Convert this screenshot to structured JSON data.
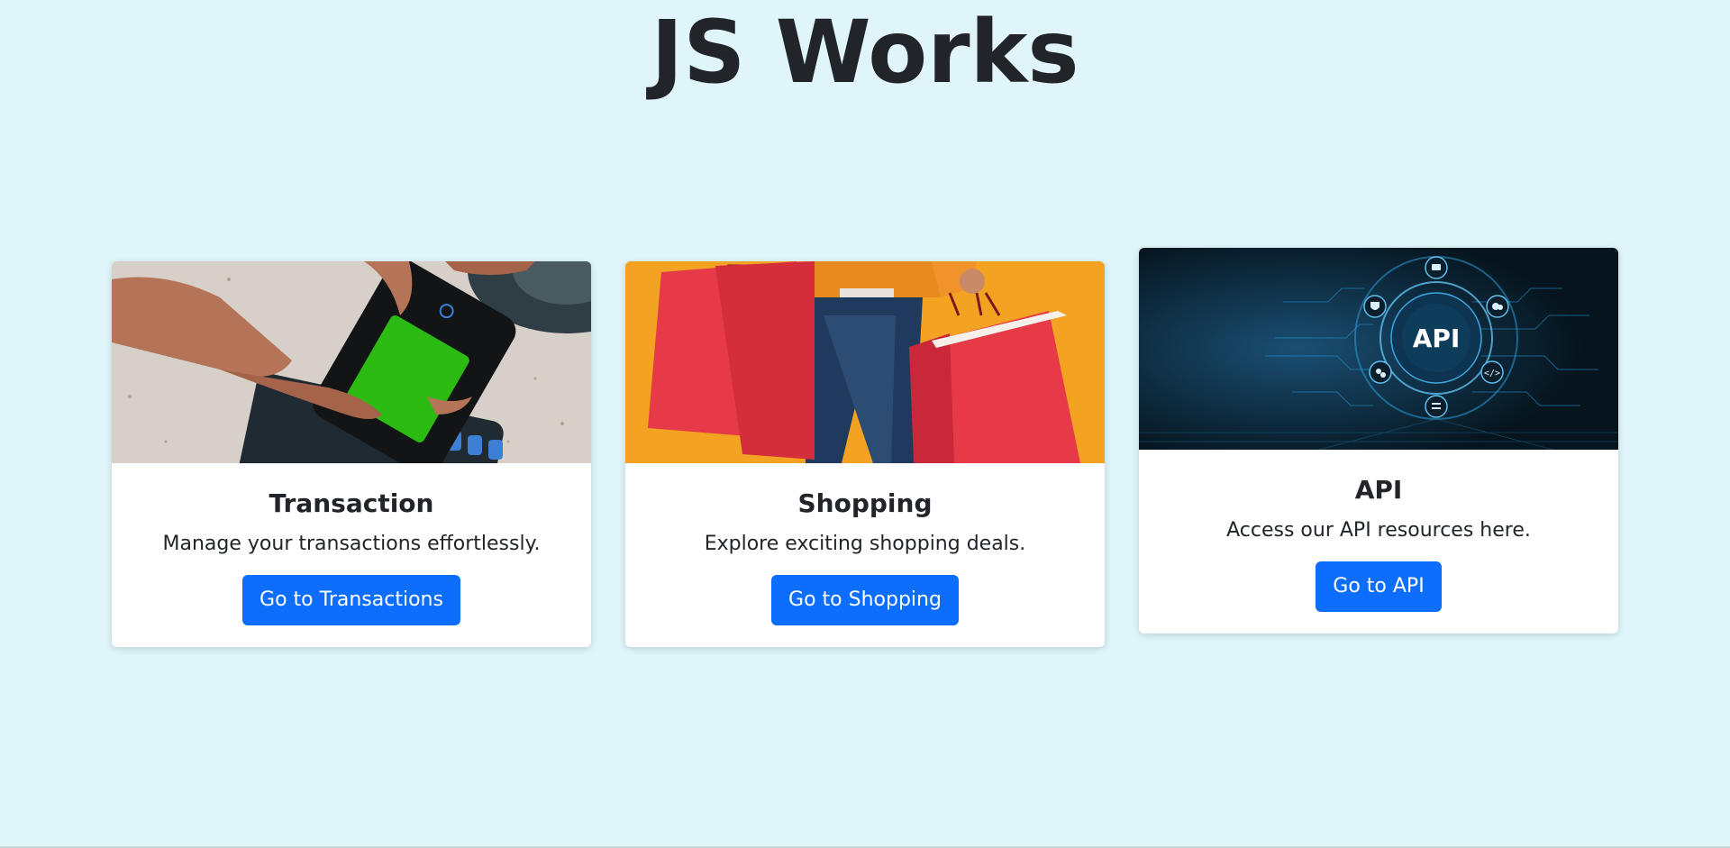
{
  "page": {
    "title": "JS Works"
  },
  "cards": [
    {
      "title": "Transaction",
      "text": "Manage your transactions effortlessly.",
      "button_label": "Go to Transactions",
      "image": "phone-payment-terminal"
    },
    {
      "title": "Shopping",
      "text": "Explore exciting shopping deals.",
      "button_label": "Go to Shopping",
      "image": "person-with-red-shopping-bags"
    },
    {
      "title": "API",
      "text": "Access our API resources here.",
      "button_label": "Go to API",
      "image": "api-circuit-graphic",
      "image_label": "API"
    }
  ],
  "colors": {
    "background": "#dff5f9",
    "button": "#0d6efd",
    "card": "#ffffff",
    "shopping_bg": "#f3a321",
    "bag_red": "#e8323f",
    "api_bg": "#0a1e2c",
    "api_glow": "#2a9ad8",
    "phone_screen": "#2bbb12"
  }
}
